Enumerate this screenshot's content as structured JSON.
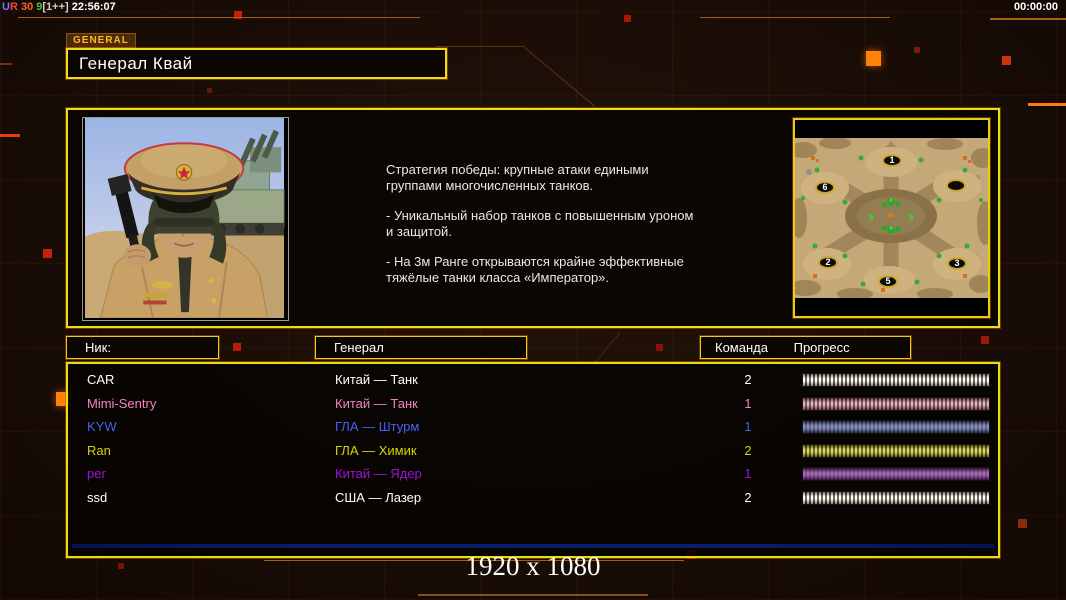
{
  "hud": {
    "left_segments": [
      {
        "text": "U",
        "color": "#6a7bff"
      },
      {
        "text": "R",
        "color": "#ff4133"
      },
      {
        "text": " 30",
        "color": "#ff6426"
      },
      {
        "text": " 9",
        "color": "#49c43b"
      },
      {
        "text": "[1++]",
        "color": "#d0d0d0"
      },
      {
        "text": " 22:56:07",
        "color": "#ffffff"
      }
    ],
    "timer": "00:00:00"
  },
  "header": {
    "tab": "GENERAL",
    "title": "Генерал Квай"
  },
  "strategy": {
    "p1": "Стратегия победы: крупные атаки едиными\n группами многочисленных танков.",
    "p2": "- Уникальный набор танков с повышенным уроном\n и защитой.",
    "p3": "- На 3м Ранге открываются крайне эффективные\n тяжёлые танки класса «Император»."
  },
  "map": {
    "spawn_labels": [
      "1",
      "6",
      "",
      "2",
      "3",
      "5"
    ]
  },
  "table": {
    "headers": {
      "nick": "Ник:",
      "general": "Генерал",
      "team": "Команда",
      "progress": "Прогресс"
    }
  },
  "players": [
    {
      "nick": "CAR",
      "general": "Китай — Танк",
      "team": "2",
      "color": "#ffffff"
    },
    {
      "nick": "Mimi-Sentry",
      "general": "Китай — Танк",
      "team": "1",
      "color": "#f583c0"
    },
    {
      "nick": "KYW",
      "general": "ГЛА — Штурм",
      "team": "1",
      "color": "#4463f0"
    },
    {
      "nick": "Ran",
      "general": "ГЛА — Химик",
      "team": "2",
      "color": "#d6d600"
    },
    {
      "nick": "per",
      "general": "Китай — Ядер",
      "team": "1",
      "color": "#9a14dd"
    },
    {
      "nick": "ssd",
      "general": "США — Лазер",
      "team": "2",
      "color": "#ffffff"
    }
  ],
  "watermark": "1920 x 1080"
}
